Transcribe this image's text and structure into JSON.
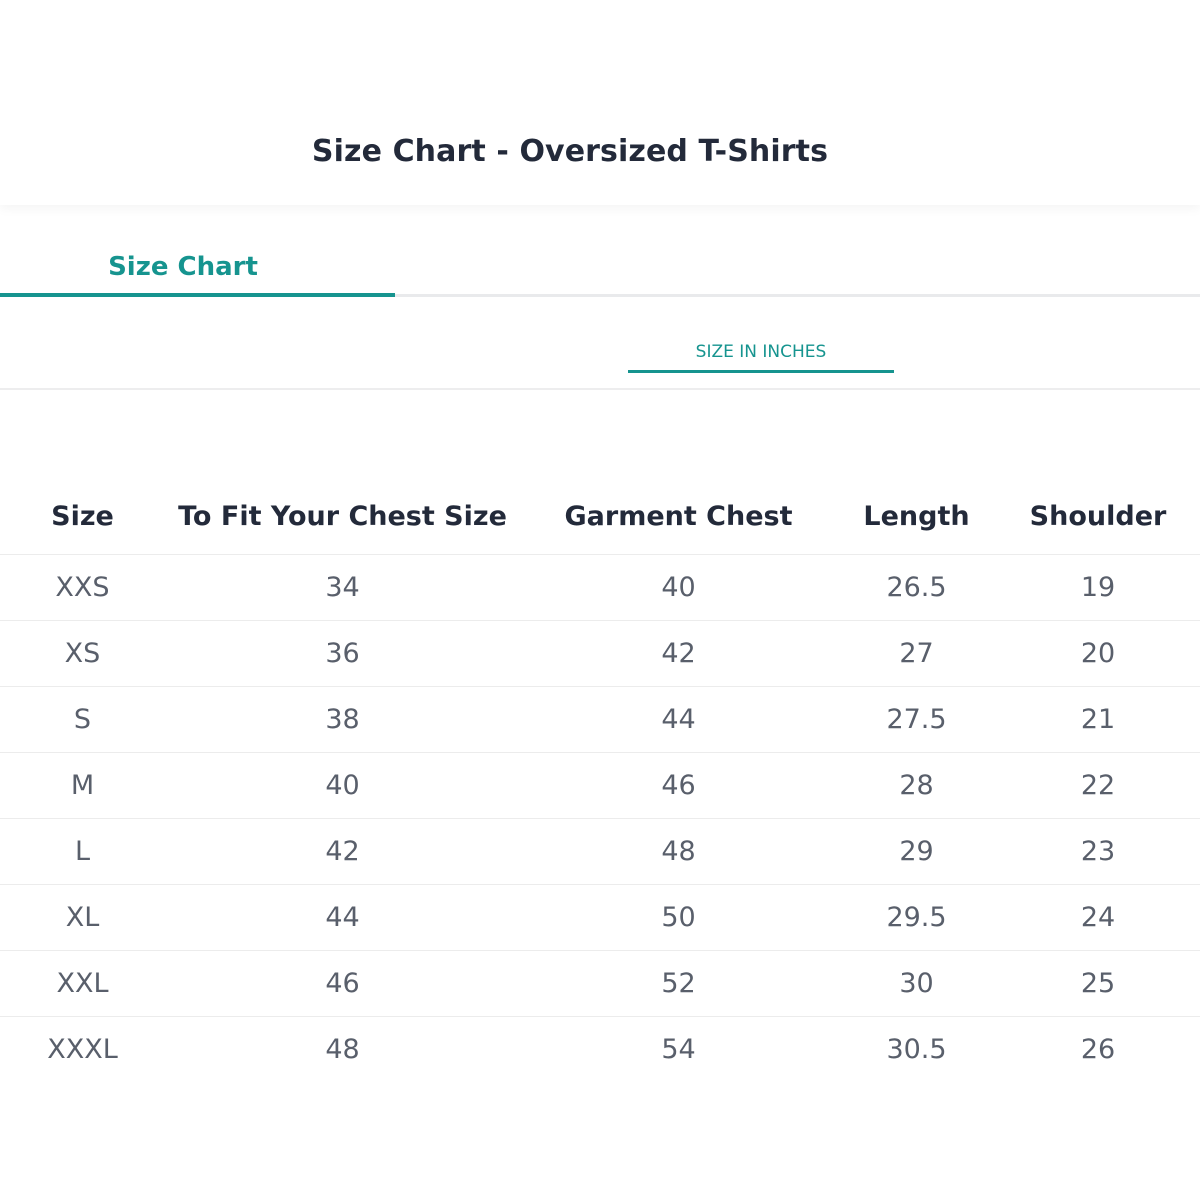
{
  "header": {
    "title": "Size Chart - Oversized T-Shirts"
  },
  "tabs": [
    {
      "label": "Size Chart",
      "active": true
    }
  ],
  "unit_toggle": {
    "label": "SIZE IN INCHES"
  },
  "table": {
    "columns": [
      "Size",
      "To Fit Your Chest Size",
      "Garment Chest",
      "Length",
      "Shoulder"
    ],
    "rows": [
      [
        "XXS",
        "34",
        "40",
        "26.5",
        "19"
      ],
      [
        "XS",
        "36",
        "42",
        "27",
        "20"
      ],
      [
        "S",
        "38",
        "44",
        "27.5",
        "21"
      ],
      [
        "M",
        "40",
        "46",
        "28",
        "22"
      ],
      [
        "L",
        "42",
        "48",
        "29",
        "23"
      ],
      [
        "XL",
        "44",
        "50",
        "29.5",
        "24"
      ],
      [
        "XXL",
        "46",
        "52",
        "30",
        "25"
      ],
      [
        "XXXL",
        "48",
        "54",
        "30.5",
        "26"
      ]
    ]
  },
  "colors": {
    "accent": "#16948f",
    "title": "#232a3a",
    "cell_text": "#595f6b",
    "divider": "#ececec"
  }
}
